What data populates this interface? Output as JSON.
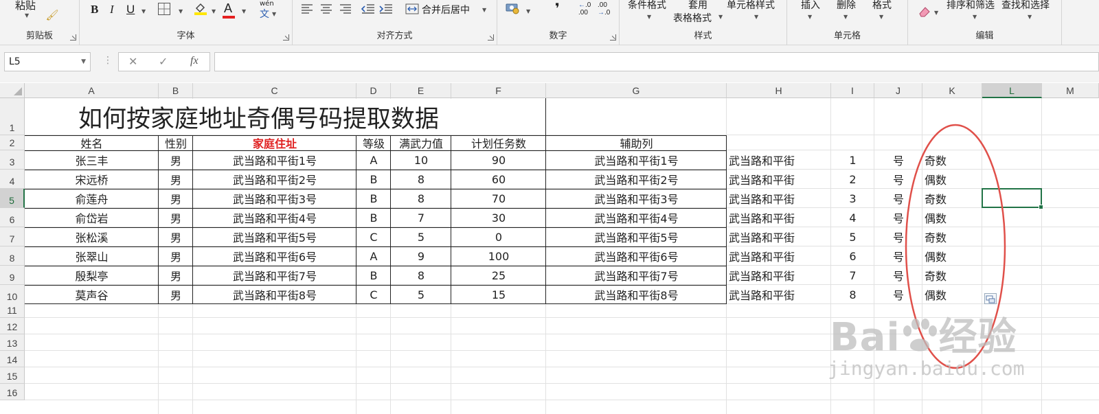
{
  "ribbon": {
    "clipboard": {
      "paste": "粘贴",
      "title": "剪贴板"
    },
    "font": {
      "title": "字体",
      "bold": "B",
      "italic": "I",
      "underline": "U",
      "phonetic_top": "wén",
      "phonetic_bottom": "文",
      "font_color_glyph": "A"
    },
    "alignment": {
      "merge_center": "合并后居中",
      "title": "对齐方式"
    },
    "number": {
      "percent": "%",
      "comma": "❜",
      "increase_decimal": ".00",
      "decrease_decimal": ".0",
      "title": "数字"
    },
    "styles": {
      "conditional_format": "条件格式",
      "apply_top": "套用",
      "table_format": "表格格式",
      "cell_styles": "单元格样式",
      "title": "样式"
    },
    "cells": {
      "insert": "插入",
      "delete": "删除",
      "format": "格式",
      "title": "单元格"
    },
    "editing": {
      "sort_filter": "排序和筛选",
      "find_select": "查找和选择",
      "title": "编辑"
    }
  },
  "formula_bar": {
    "name_box": "L5",
    "cancel": "✕",
    "enter": "✓",
    "fx": "fx",
    "sep": "⋮",
    "content": ""
  },
  "columns": [
    "A",
    "B",
    "C",
    "D",
    "E",
    "F",
    "G",
    "H",
    "I",
    "J",
    "K",
    "L",
    "M"
  ],
  "rows": [
    "1",
    "2",
    "3",
    "4",
    "5",
    "6",
    "7",
    "8",
    "9",
    "10",
    "11",
    "12",
    "13",
    "14",
    "15",
    "16"
  ],
  "sheet_title": "如何按家庭地址奇偶号码提取数据",
  "headers": [
    "姓名",
    "性别",
    "家庭住址",
    "等级",
    "满武力值",
    "计划任务数",
    "辅助列"
  ],
  "table_rows": [
    [
      "张三丰",
      "男",
      "武当路和平街1号",
      "A",
      "10",
      "90",
      "武当路和平街1号",
      "武当路和平街",
      "1",
      "号",
      "奇数"
    ],
    [
      "宋远桥",
      "男",
      "武当路和平街2号",
      "B",
      "8",
      "60",
      "武当路和平街2号",
      "武当路和平街",
      "2",
      "号",
      "偶数"
    ],
    [
      "俞莲舟",
      "男",
      "武当路和平街3号",
      "B",
      "8",
      "70",
      "武当路和平街3号",
      "武当路和平街",
      "3",
      "号",
      "奇数"
    ],
    [
      "俞岱岩",
      "男",
      "武当路和平街4号",
      "B",
      "7",
      "30",
      "武当路和平街4号",
      "武当路和平街",
      "4",
      "号",
      "偶数"
    ],
    [
      "张松溪",
      "男",
      "武当路和平街5号",
      "C",
      "5",
      "0",
      "武当路和平街5号",
      "武当路和平街",
      "5",
      "号",
      "奇数"
    ],
    [
      "张翠山",
      "男",
      "武当路和平街6号",
      "A",
      "9",
      "100",
      "武当路和平街6号",
      "武当路和平街",
      "6",
      "号",
      "偶数"
    ],
    [
      "殷梨亭",
      "男",
      "武当路和平街7号",
      "B",
      "8",
      "25",
      "武当路和平街7号",
      "武当路和平街",
      "7",
      "号",
      "奇数"
    ],
    [
      "莫声谷",
      "男",
      "武当路和平街8号",
      "C",
      "5",
      "15",
      "武当路和平街8号",
      "武当路和平街",
      "8",
      "号",
      "偶数"
    ]
  ],
  "active_cell": "L5",
  "colors": {
    "accent_green": "#217346",
    "address_header_red": "#e02020",
    "annotation_red": "#e0504a"
  },
  "watermark": {
    "logo_left": "Bai",
    "logo_right": "经验",
    "url": "jingyan.baidu.com"
  }
}
